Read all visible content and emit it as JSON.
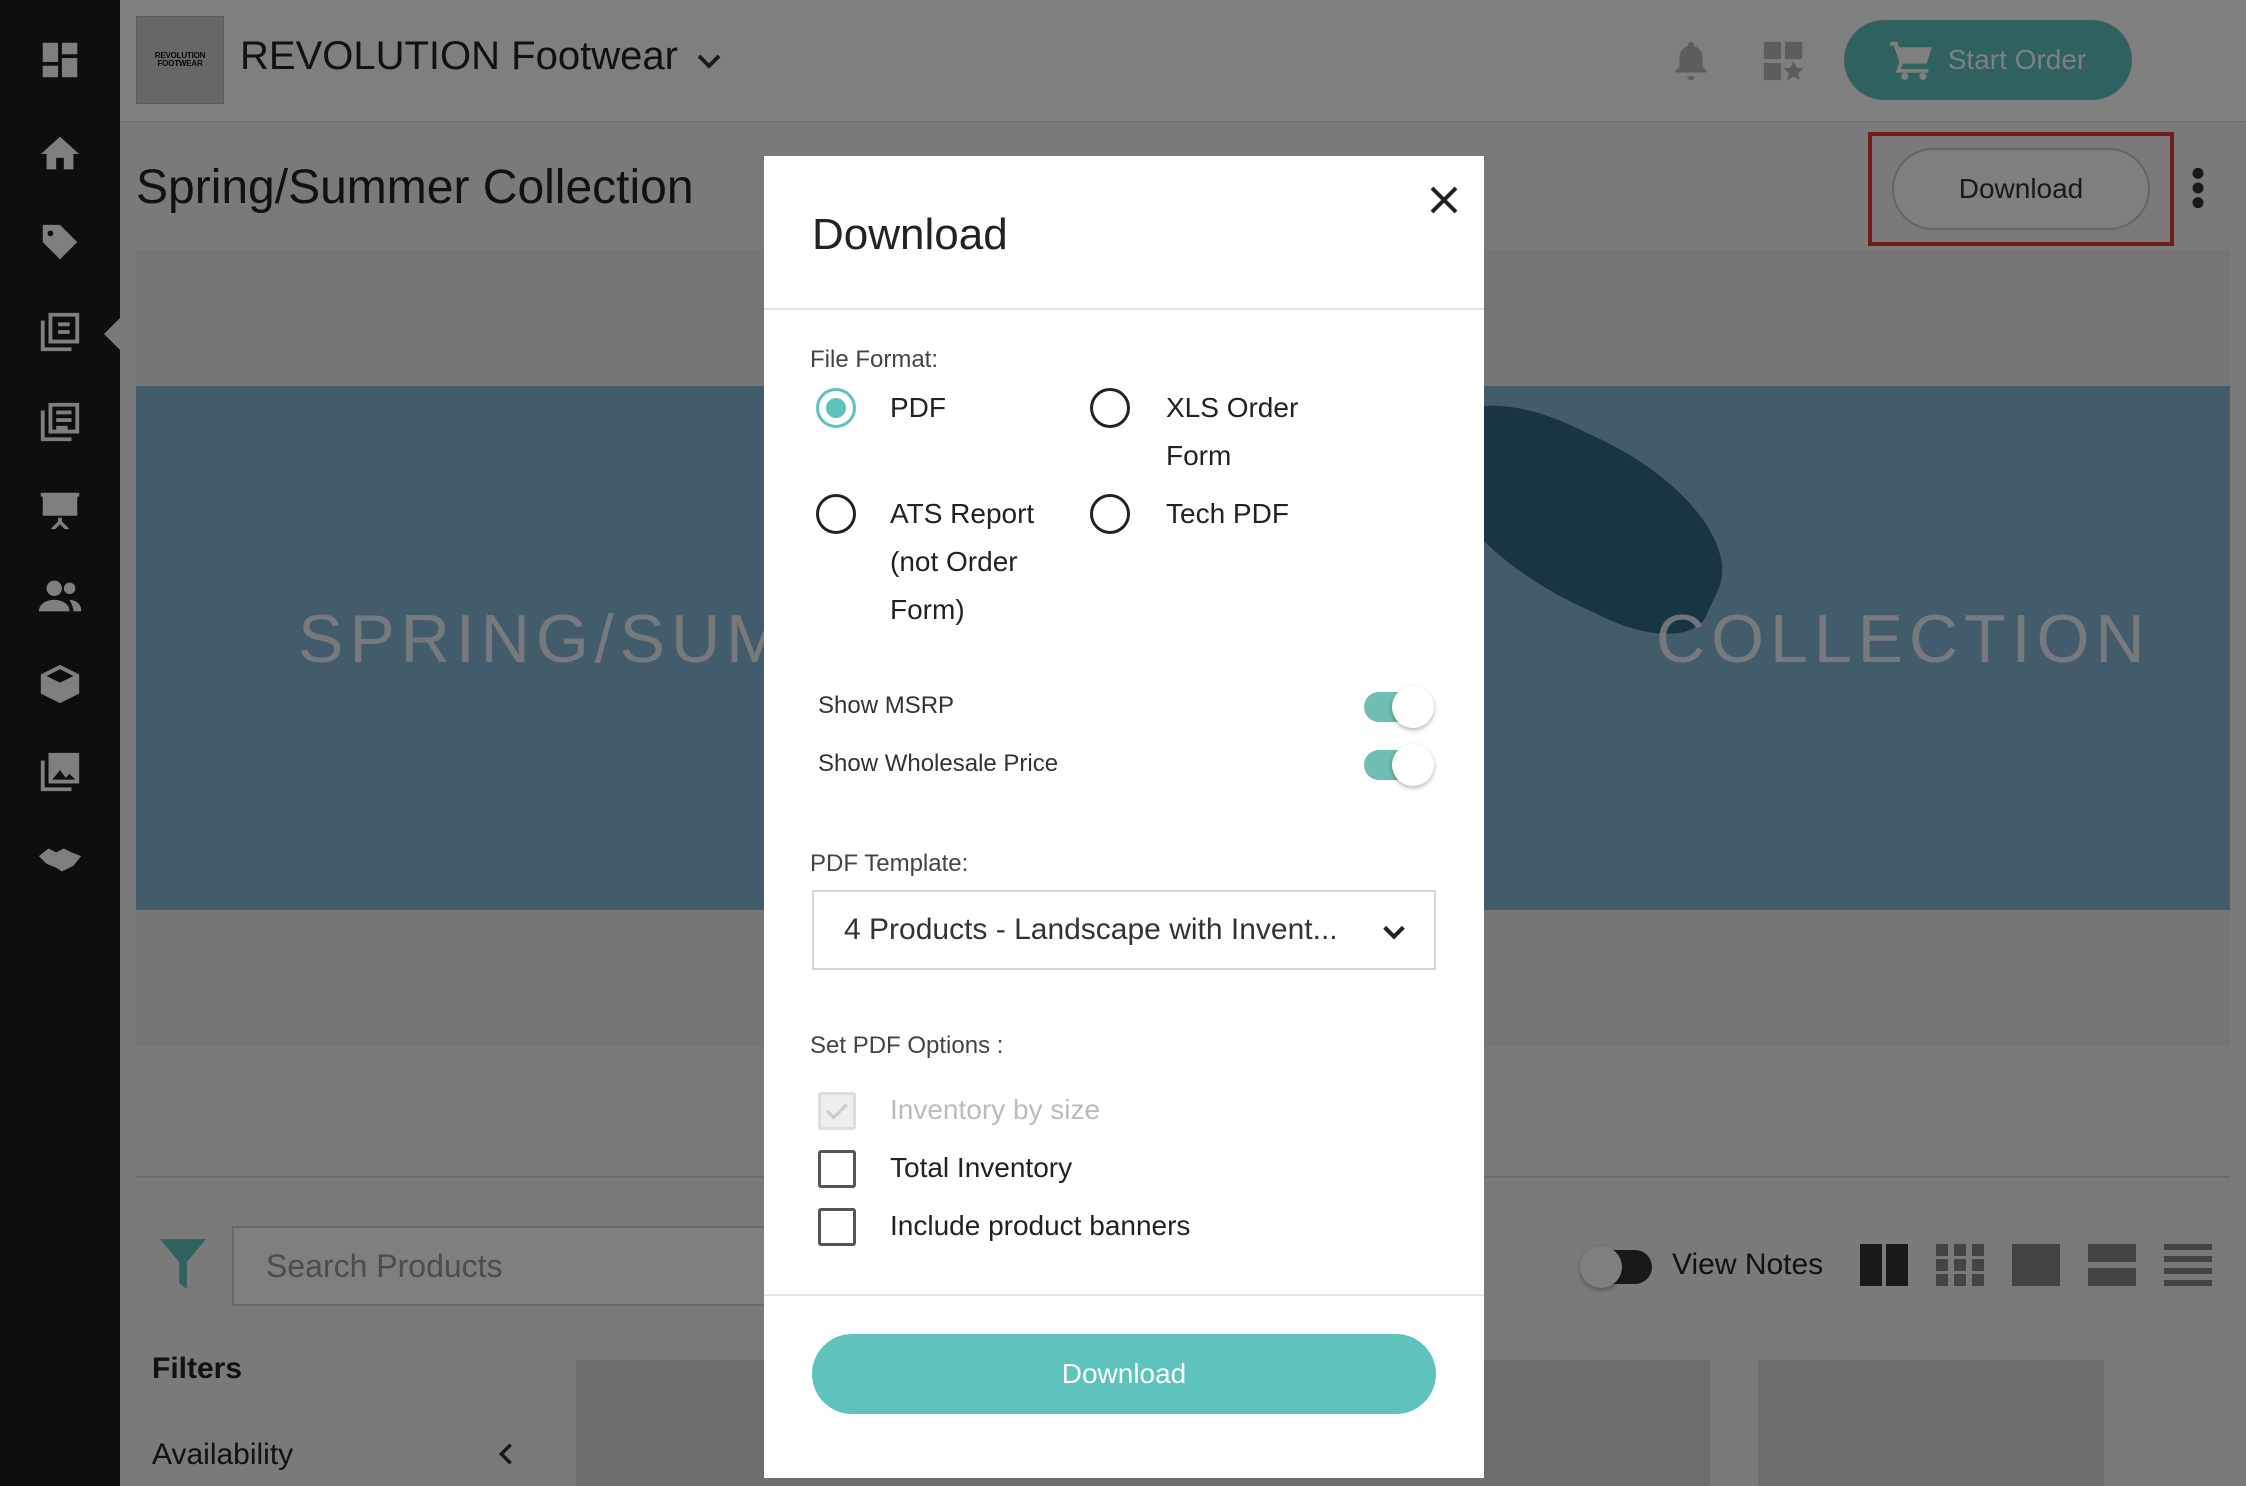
{
  "header": {
    "brand_logo_text": "REVOLUTION FOOTWEAR",
    "brand_name": "REVOLUTION Footwear",
    "start_order_label": "Start Order"
  },
  "sidebar": {
    "icons": [
      "dashboard-icon",
      "home-icon",
      "tag-icon",
      "catalog-icon",
      "linesheet-icon",
      "presentation-icon",
      "customers-icon",
      "box-icon",
      "gallery-icon",
      "handshake-icon"
    ]
  },
  "page": {
    "title": "Spring/Summer Collection",
    "download_label": "Download",
    "banner_left": "SPRING/SUMM",
    "banner_right": "COLLECTION",
    "search_placeholder": "Search Products",
    "view_notes_label": "View Notes",
    "filters_heading": "Filters",
    "availability_label": "Availability"
  },
  "modal": {
    "title": "Download",
    "file_format_label": "File Format:",
    "formats": [
      {
        "label_line1": "PDF",
        "label_line2": "",
        "label_line3": "",
        "checked": true
      },
      {
        "label_line1": "XLS Order",
        "label_line2": "Form",
        "label_line3": "",
        "checked": false
      },
      {
        "label_line1": "ATS Report",
        "label_line2": "(not Order",
        "label_line3": "Form)",
        "checked": false
      },
      {
        "label_line1": "Tech PDF",
        "label_line2": "",
        "label_line3": "",
        "checked": false
      }
    ],
    "toggles": [
      {
        "label": "Show MSRP",
        "on": true
      },
      {
        "label": "Show Wholesale Price",
        "on": true
      }
    ],
    "pdf_template_label": "PDF Template:",
    "pdf_template_value": "4 Products - Landscape with Invent...",
    "pdf_options_label": "Set PDF Options :",
    "options": [
      {
        "label": "Inventory by size",
        "checked": true,
        "disabled": true
      },
      {
        "label": "Total Inventory",
        "checked": false,
        "disabled": false
      },
      {
        "label": "Include product banners",
        "checked": false,
        "disabled": false
      }
    ],
    "download_button_label": "Download"
  },
  "colors": {
    "accent": "#5ec3bc",
    "sidebar": "#1d1d1d",
    "banner": "#86b8d6",
    "highlight": "#e53935"
  }
}
